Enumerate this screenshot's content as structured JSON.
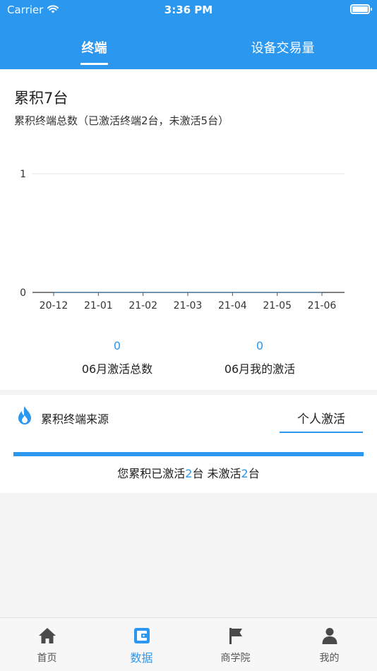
{
  "status_bar": {
    "carrier": "Carrier",
    "time": "3:36 PM"
  },
  "tabs": [
    {
      "label": "终端",
      "active": true
    },
    {
      "label": "设备交易量",
      "active": false
    }
  ],
  "summary_card": {
    "title": "累积7台",
    "subtitle": "累积终端总数（已激活终端2台，未激活5台）"
  },
  "chart_data": {
    "type": "line",
    "categories": [
      "20-12",
      "21-01",
      "21-02",
      "21-03",
      "21-04",
      "21-05",
      "21-06"
    ],
    "series": [
      {
        "values": [
          0,
          0,
          0,
          0,
          0,
          0,
          0
        ]
      }
    ],
    "y_ticks": [
      "0",
      "1"
    ],
    "ylim": [
      0,
      1
    ],
    "grid": true,
    "title": "",
    "xlabel": "",
    "ylabel": ""
  },
  "stats": [
    {
      "value": "0",
      "label": "06月激活总数"
    },
    {
      "value": "0",
      "label": "06月我的激活"
    }
  ],
  "source_card": {
    "title": "累积终端来源",
    "tab_label": "个人激活",
    "progress_fraction": 1.0,
    "summary_prefix": "您累积已激活",
    "activated_count": "2",
    "summary_middle": "台 未激活",
    "inactive_count": "2",
    "summary_suffix": "台"
  },
  "tabbar": [
    {
      "label": "首页",
      "icon": "home-icon",
      "active": false
    },
    {
      "label": "数据",
      "icon": "wallet-icon",
      "active": true
    },
    {
      "label": "商学院",
      "icon": "flag-icon",
      "active": false
    },
    {
      "label": "我的",
      "icon": "person-icon",
      "active": false
    }
  ],
  "colors": {
    "primary": "#2b97ee",
    "background": "#f4f4f4"
  }
}
